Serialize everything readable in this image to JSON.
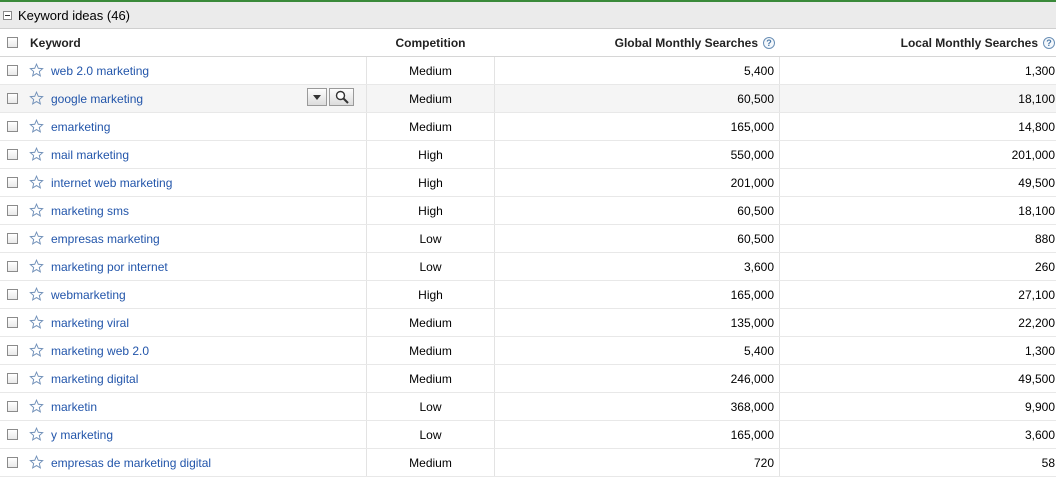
{
  "section": {
    "title": "Keyword ideas (46)"
  },
  "columns": {
    "keyword": "Keyword",
    "competition": "Competition",
    "global": "Global Monthly Searches",
    "local": "Local Monthly Searches"
  },
  "colors": {
    "link": "#2255aa",
    "accent": "#3a8a3a"
  },
  "rows": [
    {
      "keyword": "web 2.0 marketing",
      "competition": "Medium",
      "global": "5,400",
      "local": "1,300"
    },
    {
      "keyword": "google marketing",
      "competition": "Medium",
      "global": "60,500",
      "local": "18,100"
    },
    {
      "keyword": "emarketing",
      "competition": "Medium",
      "global": "165,000",
      "local": "14,800"
    },
    {
      "keyword": "mail marketing",
      "competition": "High",
      "global": "550,000",
      "local": "201,000"
    },
    {
      "keyword": "internet web marketing",
      "competition": "High",
      "global": "201,000",
      "local": "49,500"
    },
    {
      "keyword": "marketing sms",
      "competition": "High",
      "global": "60,500",
      "local": "18,100"
    },
    {
      "keyword": "empresas marketing",
      "competition": "Low",
      "global": "60,500",
      "local": "880"
    },
    {
      "keyword": "marketing por internet",
      "competition": "Low",
      "global": "3,600",
      "local": "260"
    },
    {
      "keyword": "webmarketing",
      "competition": "High",
      "global": "165,000",
      "local": "27,100"
    },
    {
      "keyword": "marketing viral",
      "competition": "Medium",
      "global": "135,000",
      "local": "22,200"
    },
    {
      "keyword": "marketing web 2.0",
      "competition": "Medium",
      "global": "5,400",
      "local": "1,300"
    },
    {
      "keyword": "marketing digital",
      "competition": "Medium",
      "global": "246,000",
      "local": "49,500"
    },
    {
      "keyword": "marketin",
      "competition": "Low",
      "global": "368,000",
      "local": "9,900"
    },
    {
      "keyword": "y marketing",
      "competition": "Low",
      "global": "165,000",
      "local": "3,600"
    },
    {
      "keyword": "empresas de marketing digital",
      "competition": "Medium",
      "global": "720",
      "local": "58"
    }
  ]
}
